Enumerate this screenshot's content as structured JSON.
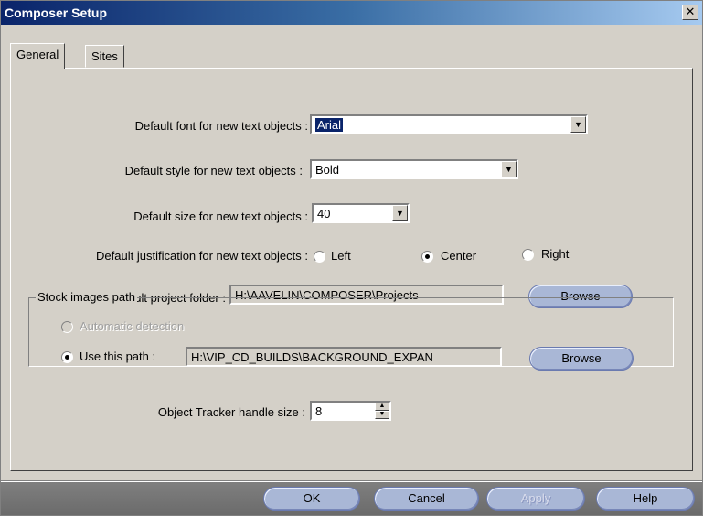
{
  "window": {
    "title": "Composer Setup",
    "close_glyph": "✕"
  },
  "tabs": [
    {
      "label": "General",
      "active": true
    },
    {
      "label": "Sites",
      "active": false
    }
  ],
  "general": {
    "font_label": "Default font for new text objects :",
    "font_value": "Arial",
    "style_label": "Default style for new text objects :",
    "style_value": "Bold",
    "size_label": "Default size for new text objects :",
    "size_value": "40",
    "justification_label": "Default justification for new text objects :",
    "justification_options": [
      {
        "label": "Left",
        "selected": false
      },
      {
        "label": "Center",
        "selected": true
      },
      {
        "label": "Right",
        "selected": false
      }
    ],
    "project_folder_label": "Default project folder :",
    "project_folder_value": "H:\\AAVELIN\\COMPOSER\\Projects",
    "browse_label": "Browse",
    "stock_group_title": "Stock images path",
    "auto_detect_label": "Automatic detection",
    "use_path_label": "Use this path :",
    "use_path_value": "H:\\VIP_CD_BUILDS\\BACKGROUND_EXPAN",
    "tracker_label": "Object Tracker handle size :",
    "tracker_value": "8"
  },
  "footer": {
    "ok": "OK",
    "cancel": "Cancel",
    "apply": "Apply",
    "help": "Help"
  },
  "icons": {
    "dropdown": "chevron-down-icon",
    "spin_up": "spin-up-icon",
    "spin_down": "spin-down-icon"
  },
  "colors": {
    "title_bar": "#0a246a",
    "selection": "#0a246a",
    "button_pill": "#a9b7d6",
    "dialog_bg": "#d4d0c8",
    "footer_bg": "#737373"
  }
}
